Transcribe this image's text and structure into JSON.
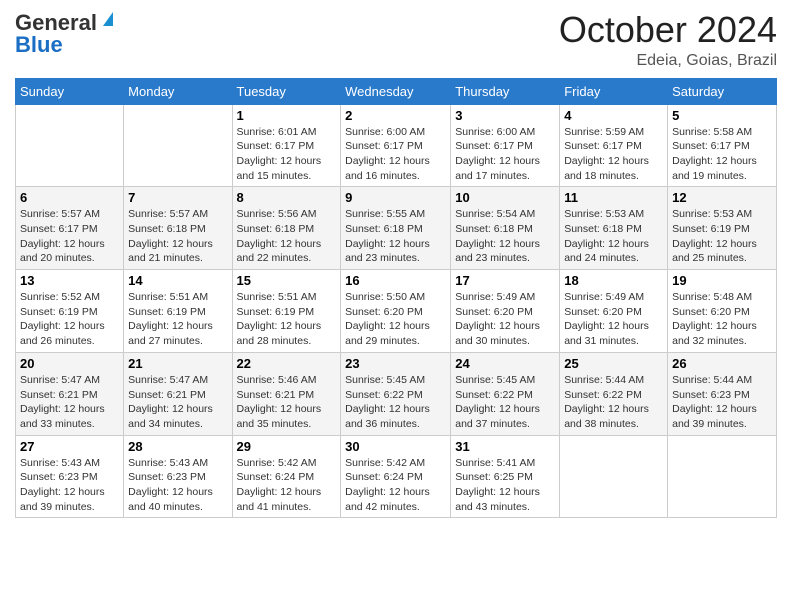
{
  "header": {
    "logo_general": "General",
    "logo_blue": "Blue",
    "month_title": "October 2024",
    "location": "Edeia, Goias, Brazil"
  },
  "days_of_week": [
    "Sunday",
    "Monday",
    "Tuesday",
    "Wednesday",
    "Thursday",
    "Friday",
    "Saturday"
  ],
  "weeks": [
    [
      {
        "day": "",
        "sunrise": "",
        "sunset": "",
        "daylight": ""
      },
      {
        "day": "",
        "sunrise": "",
        "sunset": "",
        "daylight": ""
      },
      {
        "day": "1",
        "sunrise": "Sunrise: 6:01 AM",
        "sunset": "Sunset: 6:17 PM",
        "daylight": "Daylight: 12 hours and 15 minutes."
      },
      {
        "day": "2",
        "sunrise": "Sunrise: 6:00 AM",
        "sunset": "Sunset: 6:17 PM",
        "daylight": "Daylight: 12 hours and 16 minutes."
      },
      {
        "day": "3",
        "sunrise": "Sunrise: 6:00 AM",
        "sunset": "Sunset: 6:17 PM",
        "daylight": "Daylight: 12 hours and 17 minutes."
      },
      {
        "day": "4",
        "sunrise": "Sunrise: 5:59 AM",
        "sunset": "Sunset: 6:17 PM",
        "daylight": "Daylight: 12 hours and 18 minutes."
      },
      {
        "day": "5",
        "sunrise": "Sunrise: 5:58 AM",
        "sunset": "Sunset: 6:17 PM",
        "daylight": "Daylight: 12 hours and 19 minutes."
      }
    ],
    [
      {
        "day": "6",
        "sunrise": "Sunrise: 5:57 AM",
        "sunset": "Sunset: 6:17 PM",
        "daylight": "Daylight: 12 hours and 20 minutes."
      },
      {
        "day": "7",
        "sunrise": "Sunrise: 5:57 AM",
        "sunset": "Sunset: 6:18 PM",
        "daylight": "Daylight: 12 hours and 21 minutes."
      },
      {
        "day": "8",
        "sunrise": "Sunrise: 5:56 AM",
        "sunset": "Sunset: 6:18 PM",
        "daylight": "Daylight: 12 hours and 22 minutes."
      },
      {
        "day": "9",
        "sunrise": "Sunrise: 5:55 AM",
        "sunset": "Sunset: 6:18 PM",
        "daylight": "Daylight: 12 hours and 23 minutes."
      },
      {
        "day": "10",
        "sunrise": "Sunrise: 5:54 AM",
        "sunset": "Sunset: 6:18 PM",
        "daylight": "Daylight: 12 hours and 23 minutes."
      },
      {
        "day": "11",
        "sunrise": "Sunrise: 5:53 AM",
        "sunset": "Sunset: 6:18 PM",
        "daylight": "Daylight: 12 hours and 24 minutes."
      },
      {
        "day": "12",
        "sunrise": "Sunrise: 5:53 AM",
        "sunset": "Sunset: 6:19 PM",
        "daylight": "Daylight: 12 hours and 25 minutes."
      }
    ],
    [
      {
        "day": "13",
        "sunrise": "Sunrise: 5:52 AM",
        "sunset": "Sunset: 6:19 PM",
        "daylight": "Daylight: 12 hours and 26 minutes."
      },
      {
        "day": "14",
        "sunrise": "Sunrise: 5:51 AM",
        "sunset": "Sunset: 6:19 PM",
        "daylight": "Daylight: 12 hours and 27 minutes."
      },
      {
        "day": "15",
        "sunrise": "Sunrise: 5:51 AM",
        "sunset": "Sunset: 6:19 PM",
        "daylight": "Daylight: 12 hours and 28 minutes."
      },
      {
        "day": "16",
        "sunrise": "Sunrise: 5:50 AM",
        "sunset": "Sunset: 6:20 PM",
        "daylight": "Daylight: 12 hours and 29 minutes."
      },
      {
        "day": "17",
        "sunrise": "Sunrise: 5:49 AM",
        "sunset": "Sunset: 6:20 PM",
        "daylight": "Daylight: 12 hours and 30 minutes."
      },
      {
        "day": "18",
        "sunrise": "Sunrise: 5:49 AM",
        "sunset": "Sunset: 6:20 PM",
        "daylight": "Daylight: 12 hours and 31 minutes."
      },
      {
        "day": "19",
        "sunrise": "Sunrise: 5:48 AM",
        "sunset": "Sunset: 6:20 PM",
        "daylight": "Daylight: 12 hours and 32 minutes."
      }
    ],
    [
      {
        "day": "20",
        "sunrise": "Sunrise: 5:47 AM",
        "sunset": "Sunset: 6:21 PM",
        "daylight": "Daylight: 12 hours and 33 minutes."
      },
      {
        "day": "21",
        "sunrise": "Sunrise: 5:47 AM",
        "sunset": "Sunset: 6:21 PM",
        "daylight": "Daylight: 12 hours and 34 minutes."
      },
      {
        "day": "22",
        "sunrise": "Sunrise: 5:46 AM",
        "sunset": "Sunset: 6:21 PM",
        "daylight": "Daylight: 12 hours and 35 minutes."
      },
      {
        "day": "23",
        "sunrise": "Sunrise: 5:45 AM",
        "sunset": "Sunset: 6:22 PM",
        "daylight": "Daylight: 12 hours and 36 minutes."
      },
      {
        "day": "24",
        "sunrise": "Sunrise: 5:45 AM",
        "sunset": "Sunset: 6:22 PM",
        "daylight": "Daylight: 12 hours and 37 minutes."
      },
      {
        "day": "25",
        "sunrise": "Sunrise: 5:44 AM",
        "sunset": "Sunset: 6:22 PM",
        "daylight": "Daylight: 12 hours and 38 minutes."
      },
      {
        "day": "26",
        "sunrise": "Sunrise: 5:44 AM",
        "sunset": "Sunset: 6:23 PM",
        "daylight": "Daylight: 12 hours and 39 minutes."
      }
    ],
    [
      {
        "day": "27",
        "sunrise": "Sunrise: 5:43 AM",
        "sunset": "Sunset: 6:23 PM",
        "daylight": "Daylight: 12 hours and 39 minutes."
      },
      {
        "day": "28",
        "sunrise": "Sunrise: 5:43 AM",
        "sunset": "Sunset: 6:23 PM",
        "daylight": "Daylight: 12 hours and 40 minutes."
      },
      {
        "day": "29",
        "sunrise": "Sunrise: 5:42 AM",
        "sunset": "Sunset: 6:24 PM",
        "daylight": "Daylight: 12 hours and 41 minutes."
      },
      {
        "day": "30",
        "sunrise": "Sunrise: 5:42 AM",
        "sunset": "Sunset: 6:24 PM",
        "daylight": "Daylight: 12 hours and 42 minutes."
      },
      {
        "day": "31",
        "sunrise": "Sunrise: 5:41 AM",
        "sunset": "Sunset: 6:25 PM",
        "daylight": "Daylight: 12 hours and 43 minutes."
      },
      {
        "day": "",
        "sunrise": "",
        "sunset": "",
        "daylight": ""
      },
      {
        "day": "",
        "sunrise": "",
        "sunset": "",
        "daylight": ""
      }
    ]
  ]
}
